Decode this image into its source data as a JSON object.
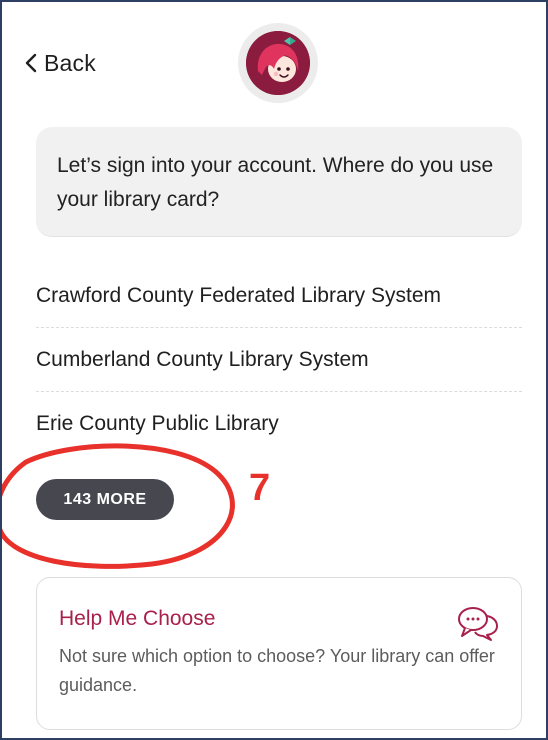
{
  "header": {
    "back_label": "Back",
    "avatar_icon": "libby-avatar-icon"
  },
  "bubble": {
    "message": "Let’s sign into your account. Where do you use your library card?"
  },
  "libraries": [
    {
      "name": "Crawford County Federated Library System"
    },
    {
      "name": "Cumberland County Library System"
    },
    {
      "name": "Erie County Public Library"
    }
  ],
  "more_button": {
    "label": "143 MORE"
  },
  "annotation": {
    "number": "7",
    "color": "#e8312b"
  },
  "help_card": {
    "title": "Help Me Choose",
    "description": "Not sure which option to choose? Your library can offer guidance.",
    "icon": "chat-bubbles-icon"
  },
  "colors": {
    "brand": "#8b1b3f",
    "accent_text": "#a8214c",
    "pill_bg": "#474750",
    "frame_border": "#2f3f63"
  }
}
